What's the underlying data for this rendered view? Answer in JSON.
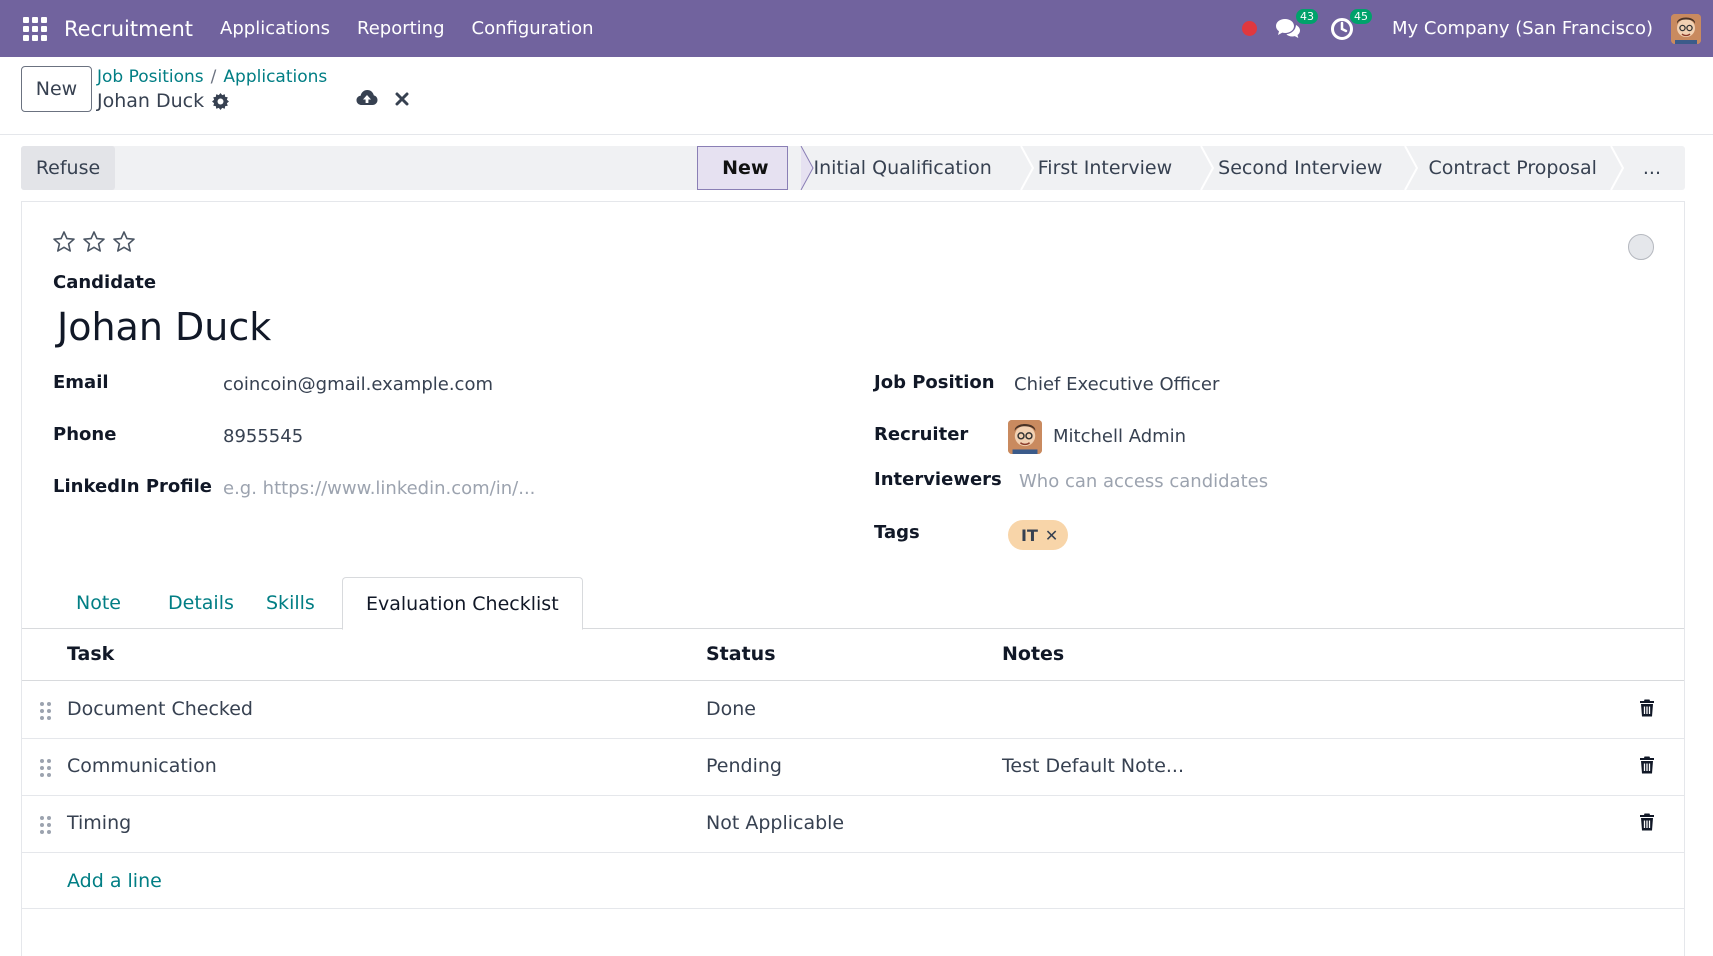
{
  "navbar": {
    "app_name": "Recruitment",
    "menu": [
      "Applications",
      "Reporting",
      "Configuration"
    ],
    "messages_badge": "43",
    "activities_badge": "45",
    "company": "My Company (San Francisco)"
  },
  "control": {
    "new_label": "New",
    "breadcrumb": [
      "Job Positions",
      "Applications"
    ],
    "breadcrumb_sep": "/",
    "record_name": "Johan Duck"
  },
  "statusbar": {
    "refuse_label": "Refuse",
    "stages": [
      "New",
      "Initial Qualification",
      "First Interview",
      "Second Interview",
      "Contract Proposal",
      "..."
    ],
    "active_stage": "New"
  },
  "form": {
    "candidate_label": "Candidate",
    "candidate_name": "Johan Duck",
    "email_label": "Email",
    "email_value": "coincoin@gmail.example.com",
    "phone_label": "Phone",
    "phone_value": "8955545",
    "linkedin_label": "LinkedIn Profile",
    "linkedin_placeholder": "e.g. https://www.linkedin.com/in/...",
    "job_position_label": "Job Position",
    "job_position_value": "Chief Executive Officer",
    "recruiter_label": "Recruiter",
    "recruiter_value": "Mitchell Admin",
    "interviewers_label": "Interviewers",
    "interviewers_placeholder": "Who can access candidates",
    "tags_label": "Tags",
    "tags": [
      "IT"
    ],
    "tag_colors": {
      "IT": "#f8d5a9"
    }
  },
  "tabs": [
    "Note",
    "Details",
    "Skills",
    "Evaluation Checklist"
  ],
  "active_tab": "Evaluation Checklist",
  "checklist": {
    "columns": [
      "Task",
      "Status",
      "Notes"
    ],
    "rows": [
      {
        "task": "Document Checked",
        "status": "Done",
        "notes": ""
      },
      {
        "task": "Communication",
        "status": "Pending",
        "notes": "Test Default Note..."
      },
      {
        "task": "Timing",
        "status": "Not Applicable",
        "notes": ""
      }
    ],
    "add_line": "Add a line"
  },
  "colors": {
    "brand": "#71639e",
    "link": "#017e84"
  }
}
